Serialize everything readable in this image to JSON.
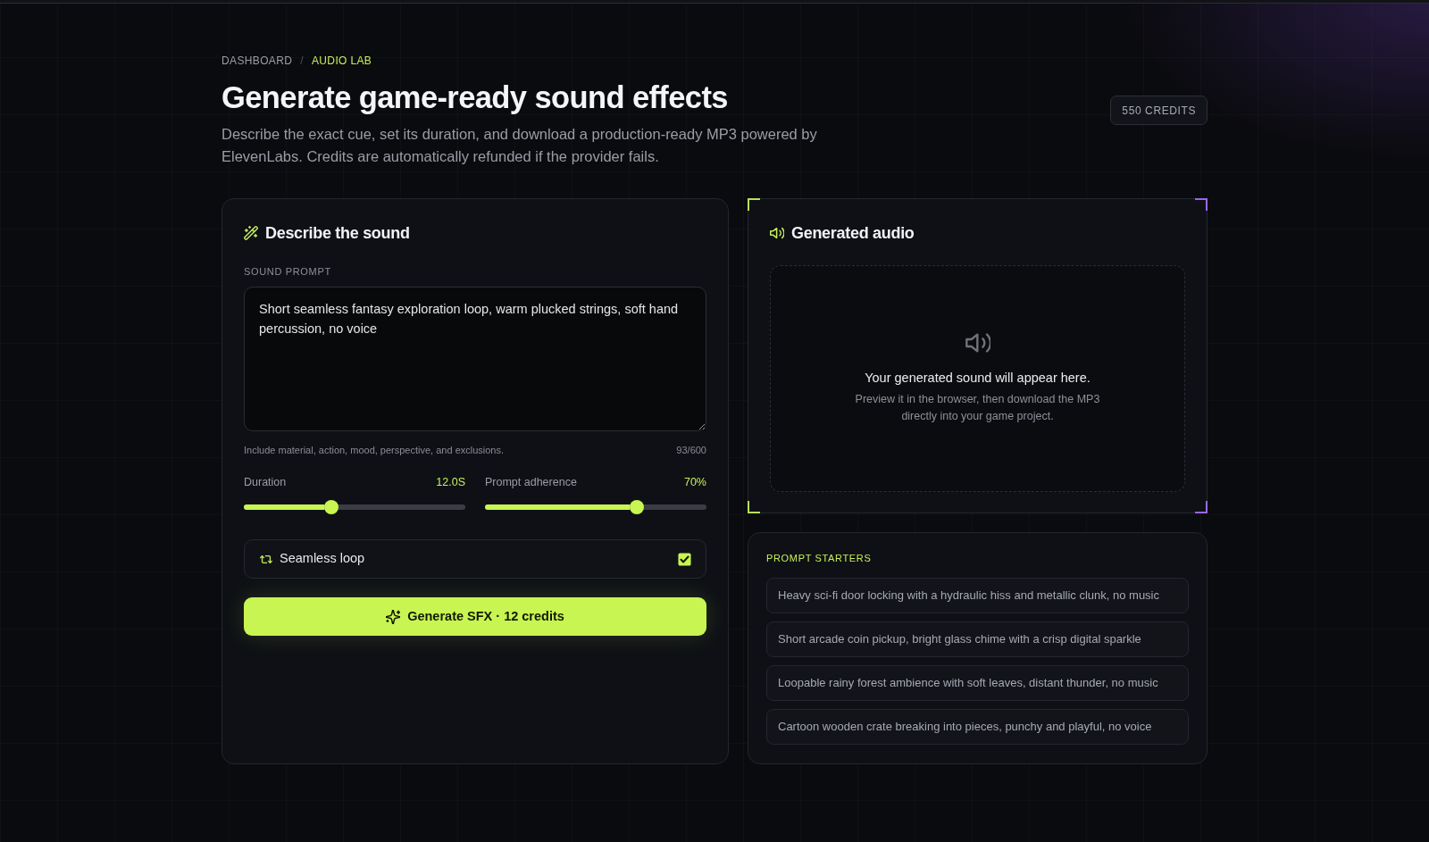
{
  "breadcrumb": {
    "separator": "/",
    "items": [
      {
        "label": "DASHBOARD",
        "active": false
      },
      {
        "label": "AUDIO LAB",
        "active": true
      }
    ]
  },
  "header": {
    "title": "Generate game-ready sound effects",
    "description": "Describe the exact cue, set its duration, and download a production-ready MP3 powered by ElevenLabs. Credits are automatically refunded if the provider fails.",
    "credits_badge": "550 CREDITS"
  },
  "prompt_card": {
    "title": "Describe the sound",
    "prompt_label": "SOUND PROMPT",
    "prompt_value": "Short seamless fantasy exploration loop, warm plucked strings, soft hand percussion, no voice",
    "hint": "Include material, action, mood, perspective, and exclusions.",
    "char_count": "93/600",
    "sliders": [
      {
        "label": "Duration",
        "reading": "12.0S",
        "level": 0.39
      },
      {
        "label": "Prompt adherence",
        "reading": "70%",
        "level": 0.7
      }
    ],
    "loop_toggle": {
      "label": "Seamless loop",
      "checked": true
    },
    "generate_button": "Generate SFX · 12 credits"
  },
  "audio_card": {
    "title": "Generated audio",
    "empty_title": "Your generated sound will appear here.",
    "empty_text": "Preview it in the browser, then download the MP3 directly into your game project."
  },
  "prompt_starters": {
    "title": "PROMPT STARTERS",
    "items": [
      "Heavy sci-fi door locking with a hydraulic hiss and metallic clunk, no music",
      "Short arcade coin pickup, bright glass chime with a crisp digital sparkle",
      "Loopable rainy forest ambience with soft leaves, distant thunder, no music",
      "Cartoon wooden crate breaking into pieces, punchy and playful, no voice"
    ]
  }
}
